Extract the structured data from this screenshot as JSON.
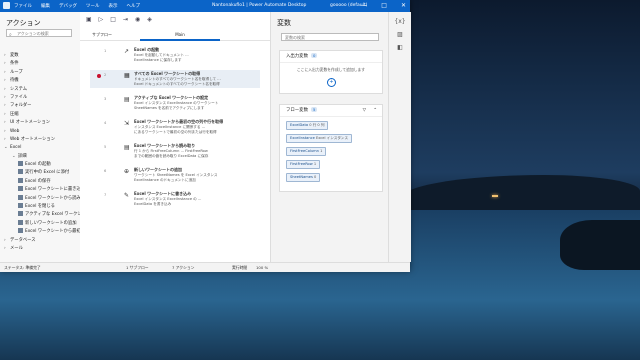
{
  "window": {
    "menu": [
      "ファイル",
      "編集",
      "デバッグ",
      "ツール",
      "表示",
      "ヘルプ"
    ],
    "title": "Nantonakuflo1 | Power Automate Desktop",
    "user": "gooooo (default)",
    "controls": [
      "—",
      "□",
      "✕"
    ]
  },
  "actions_pane": {
    "title": "アクション",
    "search_placeholder": "アクションの検索",
    "tree": [
      {
        "label": "変数",
        "level": 0
      },
      {
        "label": "条件",
        "level": 0
      },
      {
        "label": "ループ",
        "level": 0
      },
      {
        "label": "待機",
        "level": 0
      },
      {
        "label": "システム",
        "level": 0
      },
      {
        "label": "ファイル",
        "level": 0
      },
      {
        "label": "フォルダー",
        "level": 0
      },
      {
        "label": "圧縮",
        "level": 0
      },
      {
        "label": "UI オートメーション",
        "level": 0
      },
      {
        "label": "Web",
        "level": 0
      },
      {
        "label": "Web オートメーション",
        "level": 0
      },
      {
        "label": "Excel",
        "level": 0,
        "expanded": true
      },
      {
        "label": "詳細",
        "level": 1
      },
      {
        "label": "Excel の起動",
        "level": 2
      },
      {
        "label": "実行中の Excel に添付",
        "level": 2
      },
      {
        "label": "Excel の保存",
        "level": 2
      },
      {
        "label": "Excel ワークシートに書き込む",
        "level": 2
      },
      {
        "label": "Excel ワークシートから読み込む",
        "level": 2
      },
      {
        "label": "Excel を閉じる",
        "level": 2
      },
      {
        "label": "アクティブな Excel ワークシート...",
        "level": 2
      },
      {
        "label": "新しいワークシートの追加",
        "level": 2
      },
      {
        "label": "Excel ワークシートから最初...",
        "level": 2
      },
      {
        "label": "データベース",
        "level": 0
      },
      {
        "label": "メール",
        "level": 0
      }
    ]
  },
  "flow": {
    "subflows_label": "サブフロー",
    "tab": "Main",
    "steps": [
      {
        "num": "1",
        "title": "Excel の起動",
        "desc": "Excel を起動してドキュメント ...\nExcelInstance に保存します",
        "selected": false,
        "bp": false
      },
      {
        "num": "2",
        "title": "すべての Excel ワークシートの取得",
        "desc": "ドキュメントのすべてのワークシート名を取得して ...\nExcel ドキュメントのすべてのワークシート名を取得",
        "selected": true,
        "bp": true
      },
      {
        "num": "3",
        "title": "アクティブな Excel ワークシートの設定",
        "desc": "Excel インスタンス ExcelInstance のワークシート\nSheetNames を名前でアクティブにします",
        "selected": false,
        "bp": false
      },
      {
        "num": "4",
        "title": "Excel ワークシートから最初の空の列や行を取得",
        "desc": "インスタンス ExcelInstance に関係する ...\nにあるワークシートで最初の空の列または行を取得",
        "selected": false,
        "bp": false
      },
      {
        "num": "5",
        "title": "Excel ワークシートから読み取り",
        "desc": "行 1 から FirstFreeColumn ... FirstFreeRow\nまでの範囲の値を読み取り ExcelData に保存",
        "selected": false,
        "bp": false
      },
      {
        "num": "6",
        "title": "新しいワークシートの追加",
        "desc": "ワークシート SheetNames を Excel インスタンス\nExcelInstance のドキュメントに追加",
        "selected": false,
        "bp": false
      },
      {
        "num": "7",
        "title": "Excel ワークシートに書き込み",
        "desc": "Excel インスタンス ExcelInstance の ...\nExcelData を書き込み",
        "selected": false,
        "bp": false
      }
    ]
  },
  "variables_pane": {
    "title": "変数",
    "search_placeholder": "変数の検索",
    "inputs_label": "入出力変数",
    "inputs_count": "0",
    "inputs_empty": "ここに入出力変数を作成して追加します",
    "flow_label": "フロー変数",
    "flow_count": "5",
    "flow_vars": [
      {
        "name": "ExcelData",
        "value": "0 行 0 列"
      },
      {
        "name": "ExcelInstance",
        "value": "Excel インスタンス"
      },
      {
        "name": "FirstFreeColumn",
        "value": "1"
      },
      {
        "name": "FirstFreeRow",
        "value": "1"
      },
      {
        "name": "SheetNames",
        "value": "0"
      }
    ]
  },
  "status": {
    "status_text": "ステータス: 準備完了",
    "subflow": "1 サブフロー",
    "actions": "7 アクション",
    "run_time": "実行時間",
    "zoom": "100 %"
  }
}
